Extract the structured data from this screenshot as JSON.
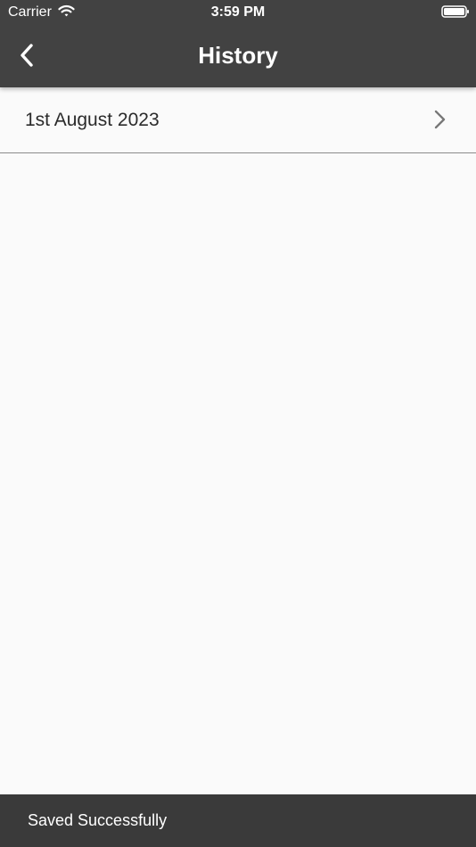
{
  "status_bar": {
    "carrier": "Carrier",
    "time": "3:59 PM",
    "wifi_icon": "wifi-icon",
    "battery_icon": "battery-icon"
  },
  "nav": {
    "title": "History",
    "back_icon": "chevron-left-icon"
  },
  "history": {
    "items": [
      {
        "label": "1st August 2023",
        "icon": "chevron-right-icon"
      }
    ]
  },
  "snackbar": {
    "message": "Saved Successfully"
  },
  "colors": {
    "header": "#424242",
    "background": "#fafafa",
    "snackbar": "#3a3a3a",
    "text": "#2b2b2b",
    "divider": "#8b8b8b"
  }
}
